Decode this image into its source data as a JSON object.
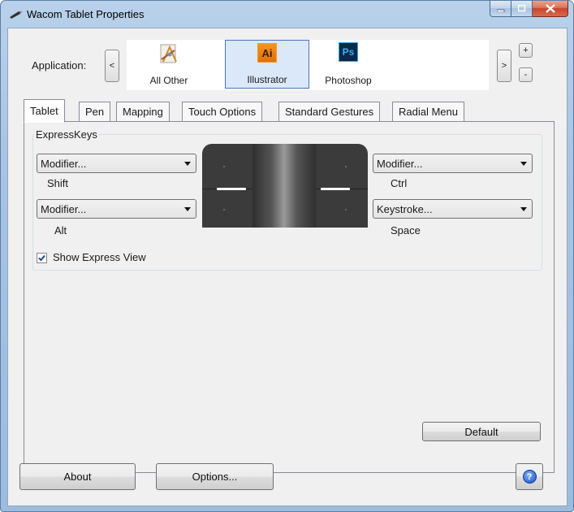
{
  "window": {
    "title": "Wacom Tablet Properties"
  },
  "application": {
    "label": "Application:",
    "prev": "<",
    "next": ">",
    "add": "+",
    "remove": "-",
    "items": [
      {
        "label": "All Other",
        "icon": "all-other-icon"
      },
      {
        "label": "Illustrator",
        "icon": "illustrator-icon",
        "abbr": "Ai",
        "selected": true
      },
      {
        "label": "Photoshop",
        "icon": "photoshop-icon",
        "abbr": "Ps"
      }
    ]
  },
  "tabs": [
    {
      "label": "Tablet",
      "active": true
    },
    {
      "label": "Pen"
    },
    {
      "label": "Mapping"
    },
    {
      "label": "Touch Options"
    },
    {
      "label": "Standard Gestures"
    },
    {
      "label": "Radial Menu"
    }
  ],
  "expresskeys": {
    "group_label": "ExpressKeys",
    "keys": [
      {
        "select": "Modifier...",
        "value": "Shift"
      },
      {
        "select": "Modifier...",
        "value": "Alt"
      },
      {
        "select": "Modifier...",
        "value": "Ctrl"
      },
      {
        "select": "Keystroke...",
        "value": "Space"
      }
    ],
    "show_express_view": {
      "label": "Show Express View",
      "checked": true
    }
  },
  "buttons": {
    "default": "Default",
    "about": "About",
    "options": "Options...",
    "help": "?"
  }
}
